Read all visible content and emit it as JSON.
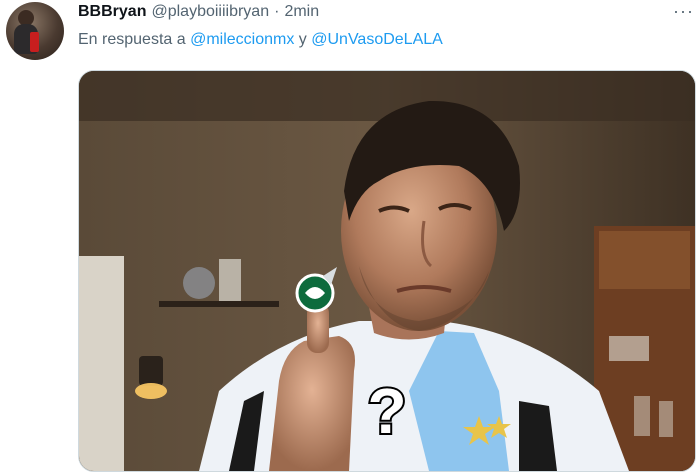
{
  "tweet": {
    "display_name": "BBBryan",
    "handle": "@playboiiiibryan",
    "separator": "·",
    "time": "2min",
    "more_glyph": "···",
    "reply_prefix": "En respuesta a",
    "reply_mention_1": "@mileccionmx",
    "reply_conjunction": "y",
    "reply_mention_2": "@UnVasoDeLALA"
  },
  "media": {
    "question_mark": "?"
  },
  "colors": {
    "link": "#1d9bf0",
    "secondary_text": "#536471",
    "primary_text": "#0f1419"
  }
}
